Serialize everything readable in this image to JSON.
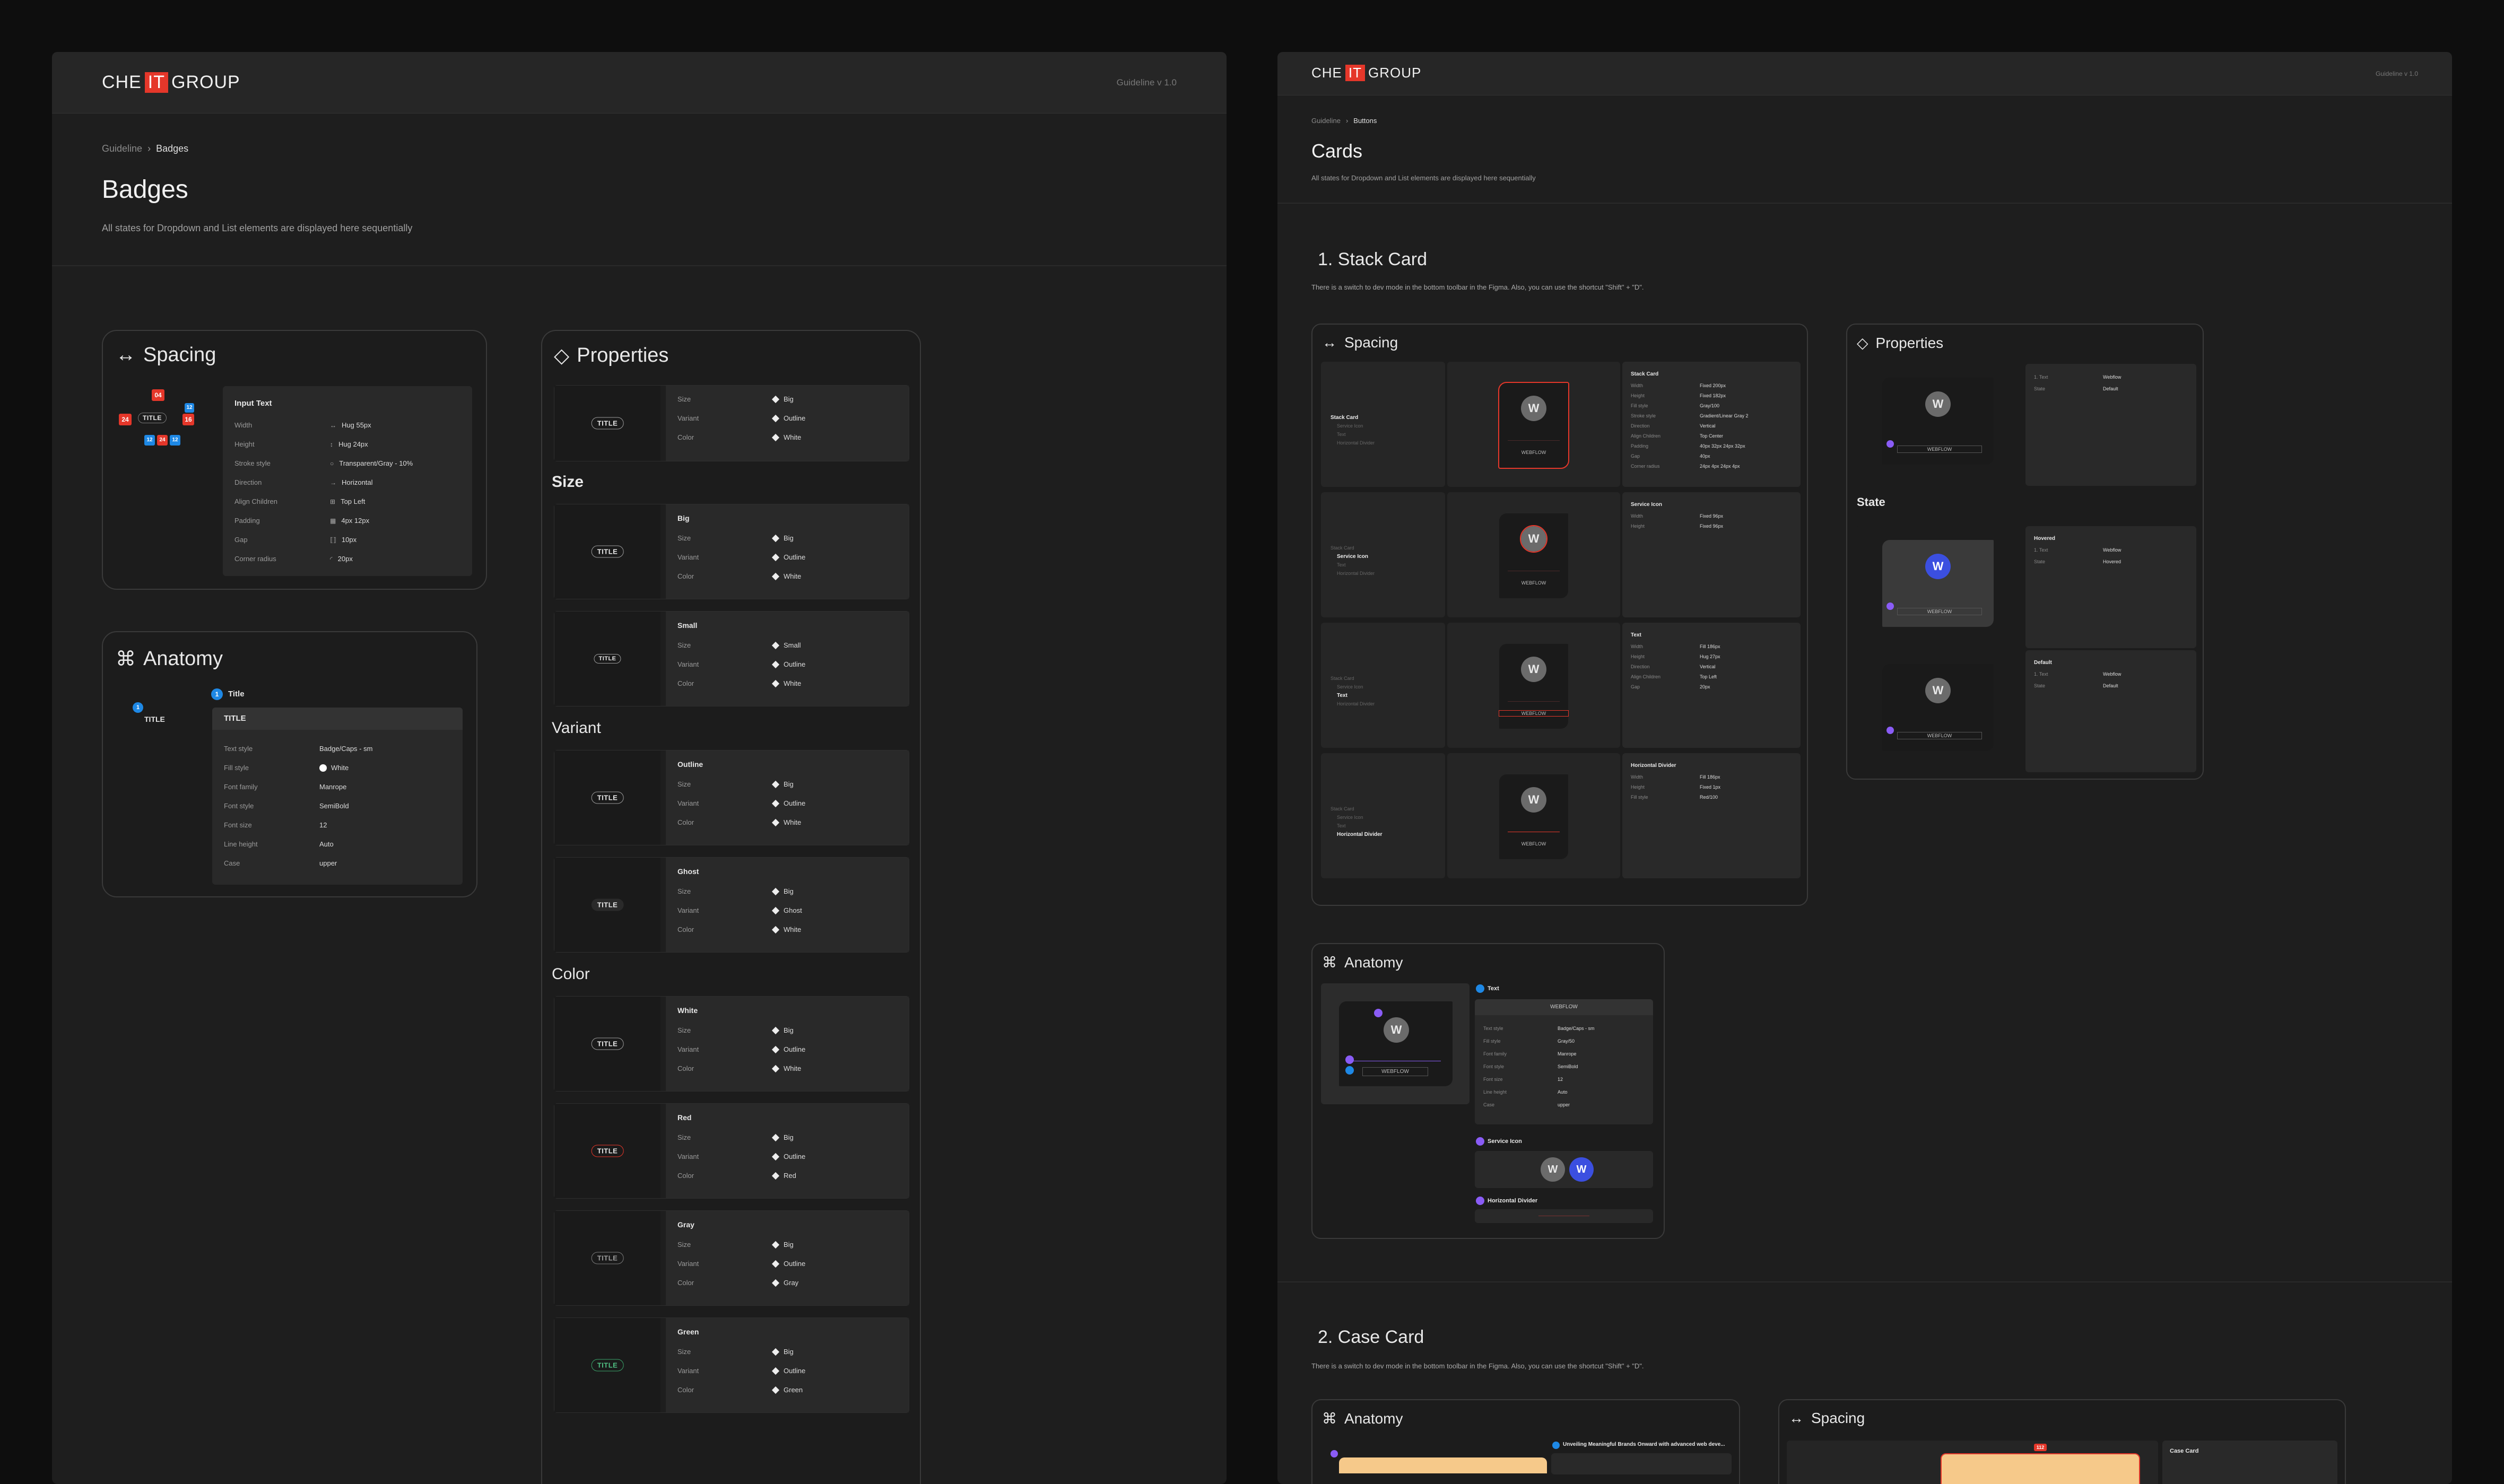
{
  "left": {
    "brand": {
      "prefix": "CHE",
      "it": "IT",
      "suffix": "GROUP"
    },
    "version": "Guideline v 1.0",
    "breadcrumb": {
      "root": "Guideline",
      "current": "Badges"
    },
    "title": "Badges",
    "description": "All states for Dropdown and List elements are displayed here sequentially",
    "spacing": {
      "title": "Spacing",
      "marks": {
        "top": "04",
        "left": "24",
        "right": "16",
        "b1": "12",
        "b2": "24",
        "b3": "12",
        "side": "12"
      },
      "badge": "TITLE",
      "panel_title": "Input Text",
      "rows": [
        {
          "k": "Width",
          "v": "Hug 55px"
        },
        {
          "k": "Height",
          "v": "Hug 24px"
        },
        {
          "k": "Stroke style",
          "v": "Transparent/Gray - 10%"
        },
        {
          "k": "Direction",
          "v": "Horizontal"
        },
        {
          "k": "Align Children",
          "v": "Top Left"
        },
        {
          "k": "Padding",
          "v": "4px 12px"
        },
        {
          "k": "Gap",
          "v": "10px"
        },
        {
          "k": "Corner radius",
          "v": "20px"
        }
      ]
    },
    "anatomy": {
      "title": "Anatomy",
      "num": "1",
      "badge": "TITLE",
      "item_title": "Title",
      "panel_title": "TITLE",
      "rows": [
        {
          "k": "Text style",
          "v": "Badge/Caps - sm"
        },
        {
          "k": "Fill style",
          "v": "White"
        },
        {
          "k": "Font family",
          "v": "Manrope"
        },
        {
          "k": "Font style",
          "v": "SemiBold"
        },
        {
          "k": "Font size",
          "v": "12"
        },
        {
          "k": "Line height",
          "v": "Auto"
        },
        {
          "k": "Case",
          "v": "upper"
        }
      ]
    },
    "properties": {
      "title": "Properties",
      "labels": {
        "size": "Size",
        "variant": "Variant",
        "color": "Color"
      },
      "badge": "TITLE",
      "default": {
        "size": "Big",
        "variant": "Outline",
        "color": "White"
      },
      "sections": [
        {
          "heading": "Size",
          "items": [
            {
              "name": "Big",
              "size": "Big",
              "variant": "Outline",
              "color": "White"
            },
            {
              "name": "Small",
              "size": "Small",
              "variant": "Outline",
              "color": "White"
            }
          ]
        },
        {
          "heading": "Variant",
          "items": [
            {
              "name": "Outline",
              "size": "Big",
              "variant": "Outline",
              "color": "White"
            },
            {
              "name": "Ghost",
              "size": "Big",
              "variant": "Ghost",
              "color": "White"
            }
          ]
        },
        {
          "heading": "Color",
          "items": [
            {
              "name": "White",
              "size": "Big",
              "variant": "Outline",
              "color": "White"
            },
            {
              "name": "Red",
              "size": "Big",
              "variant": "Outline",
              "color": "Red"
            },
            {
              "name": "Gray",
              "size": "Big",
              "variant": "Outline",
              "color": "Gray"
            },
            {
              "name": "Green",
              "size": "Big",
              "variant": "Outline",
              "color": "Green"
            }
          ]
        }
      ]
    }
  },
  "right": {
    "brand": {
      "prefix": "CHE",
      "it": "IT",
      "suffix": "GROUP"
    },
    "version": "Guideline v 1.0",
    "breadcrumb": {
      "root": "Guideline",
      "current": "Buttons"
    },
    "title": "Cards",
    "description": "All states for Dropdown and List elements are displayed here sequentially",
    "stack": {
      "heading": "1. Stack Card",
      "note": "There is a switch to dev mode in the bottom toolbar in the Figma. Also, you can use the shortcut \"Shift\" + \"D\".",
      "spacing_title": "Spacing",
      "properties_title": "Properties",
      "state_label": "State",
      "card_text": "WEBFLOW",
      "avatar": "W",
      "spacing_rows": [
        {
          "tree": [
            "Stack Card",
            "Service Icon",
            "Text",
            "Horizontal Divider"
          ],
          "active": 0,
          "title": "Stack Card",
          "props": [
            [
              "Width",
              "Fixed 200px"
            ],
            [
              "Height",
              "Fixed 182px"
            ],
            [
              "Fill style",
              "Gray/100"
            ],
            [
              "Stroke style",
              "Gradient/Linear Gray 2"
            ],
            [
              "Direction",
              "Vertical"
            ],
            [
              "Align Children",
              "Top Center"
            ],
            [
              "Padding",
              "40px 32px 24px 32px"
            ],
            [
              "Gap",
              "40px"
            ],
            [
              "Corner radius",
              "24px 4px 24px 4px"
            ]
          ]
        },
        {
          "tree": [
            "Stack Card",
            "Service Icon",
            "Text",
            "Horizontal Divider"
          ],
          "active": 1,
          "title": "Service Icon",
          "props": [
            [
              "Width",
              "Fixed 96px"
            ],
            [
              "Height",
              "Fixed 96px"
            ]
          ]
        },
        {
          "tree": [
            "Stack Card",
            "Service Icon",
            "Text",
            "Horizontal Divider"
          ],
          "active": 2,
          "title": "Text",
          "props": [
            [
              "Width",
              "Fill 186px"
            ],
            [
              "Height",
              "Hug 27px"
            ],
            [
              "Direction",
              "Vertical"
            ],
            [
              "Align Children",
              "Top Left"
            ],
            [
              "Gap",
              "20px"
            ]
          ]
        },
        {
          "tree": [
            "Stack Card",
            "Service Icon",
            "Text",
            "Horizontal Divider"
          ],
          "active": 3,
          "title": "Horizontal Divider",
          "props": [
            [
              "Width",
              "Fill 186px"
            ],
            [
              "Height",
              "Fixed 1px"
            ],
            [
              "Fill style",
              "Red/100"
            ]
          ]
        }
      ],
      "property_rows": [
        {
          "label": "",
          "props": [
            [
              "1. Text",
              "Webflow"
            ],
            [
              "State",
              "Default"
            ]
          ]
        },
        {
          "label": "Hovered",
          "props": [
            [
              "1. Text",
              "Webflow"
            ],
            [
              "State",
              "Hovered"
            ]
          ]
        },
        {
          "label": "Default",
          "props": [
            [
              "1. Text",
              "Webflow"
            ],
            [
              "State",
              "Default"
            ]
          ]
        }
      ],
      "anatomy_title": "Anatomy",
      "anatomy": {
        "item1": "Text",
        "panel_title": "WEBFLOW",
        "rows": [
          [
            "Text style",
            "Badge/Caps - sm"
          ],
          [
            "Fill style",
            "Gray/50"
          ],
          [
            "Font family",
            "Manrope"
          ],
          [
            "Font style",
            "SemiBold"
          ],
          [
            "Font size",
            "12"
          ],
          [
            "Line height",
            "Auto"
          ],
          [
            "Case",
            "upper"
          ]
        ],
        "item2": "Service Icon",
        "item3": "Horizontal Divider"
      }
    },
    "case": {
      "heading": "2. Case Card",
      "note": "There is a switch to dev mode in the bottom toolbar in the Figma. Also, you can use the shortcut \"Shift\" + \"D\".",
      "anatomy_title": "Anatomy",
      "spacing_title": "Spacing",
      "anatomy_text": "Unveiling Meaningful Brands Onward with advanced web deve...",
      "spacing_text": "Case Card"
    }
  }
}
